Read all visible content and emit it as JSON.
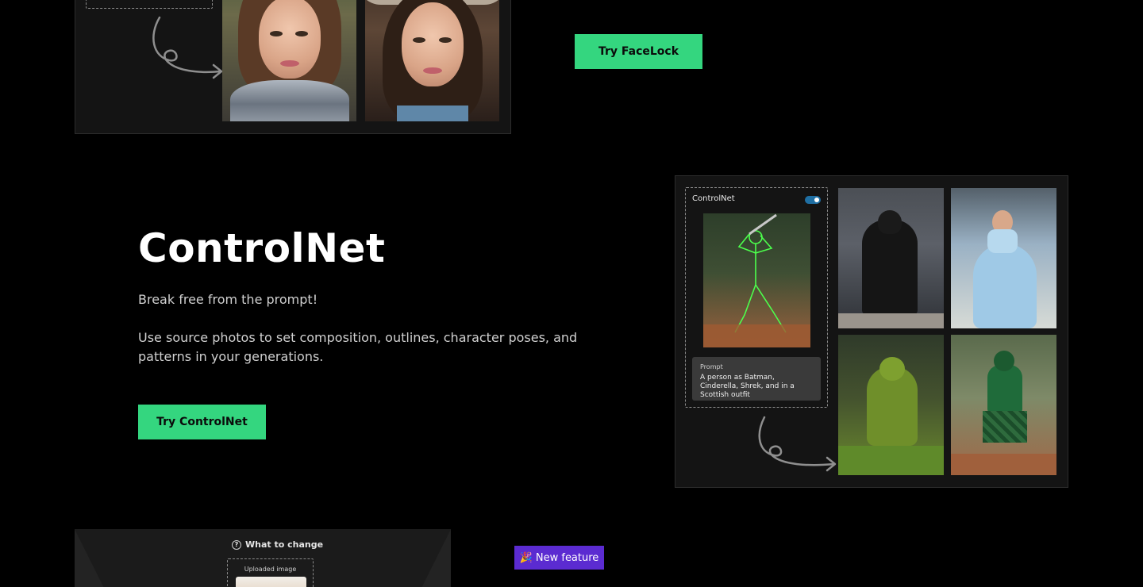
{
  "facelock": {
    "button_label": "Try FaceLock"
  },
  "controlnet": {
    "title": "ControlNet",
    "description_1": "Break free from the prompt!",
    "description_2": "Use source photos to set composition, outlines, character poses, and patterns in your generations.",
    "button_label": "Try ControlNet",
    "card": {
      "label": "ControlNet",
      "toggle_on": true,
      "prompt_label": "Prompt",
      "prompt_text": "A person as Batman, Cinderella, Shrek, and in a Scottish outfit"
    }
  },
  "edit_feature": {
    "header": "What to change",
    "uploaded_label": "Uploaded image",
    "badge_emoji": "🎉",
    "badge_label": "New feature"
  },
  "colors": {
    "accent_green": "#34d67f",
    "badge_purple": "#5b2bd1",
    "background": "#000000",
    "toggle_blue": "#1f6fa3"
  }
}
